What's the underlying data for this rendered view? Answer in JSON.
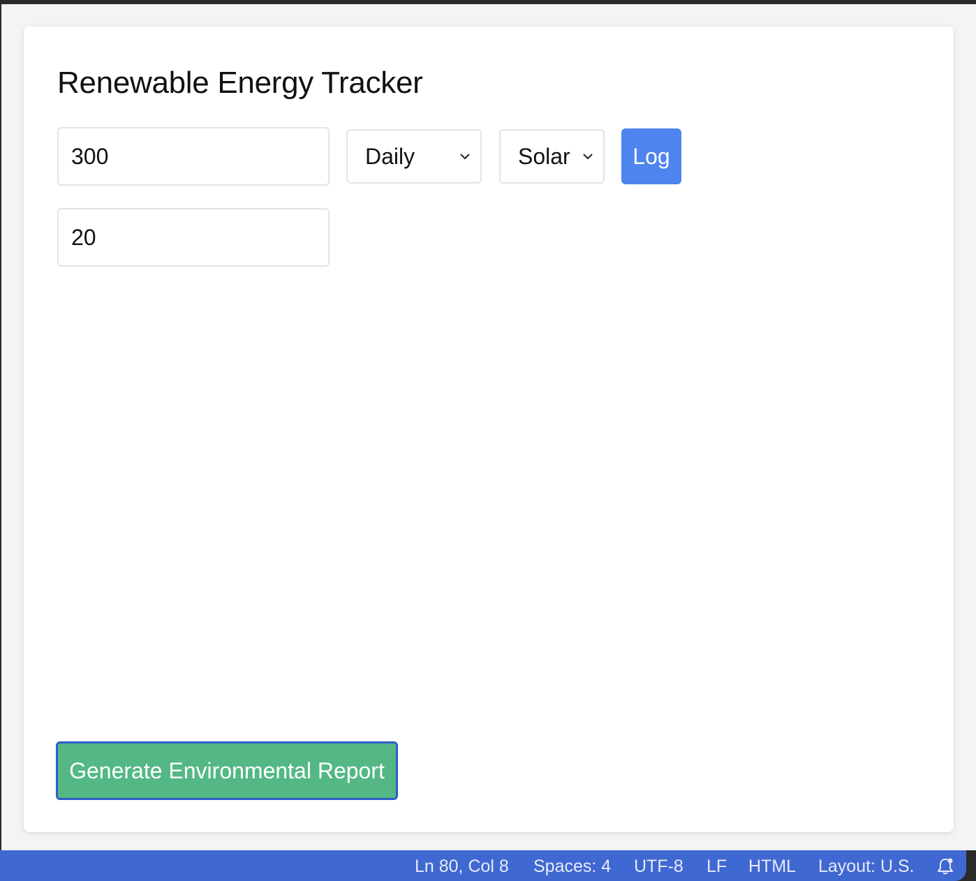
{
  "app": {
    "title": "Renewable Energy Tracker"
  },
  "form": {
    "amount_value": "300",
    "frequency_selected": "Daily",
    "source_selected": "Solar",
    "log_label": "Log",
    "hours_value": "20"
  },
  "actions": {
    "report_label": "Generate Environmental Report"
  },
  "statusbar": {
    "position": "Ln 80, Col 8",
    "spaces": "Spaces: 4",
    "encoding": "UTF-8",
    "eol": "LF",
    "language": "HTML",
    "layout": "Layout: U.S."
  },
  "colors": {
    "log_button": "#4d84ee",
    "report_button": "#54b884",
    "report_border": "#2c5ec8",
    "statusbar": "#4068d2"
  }
}
